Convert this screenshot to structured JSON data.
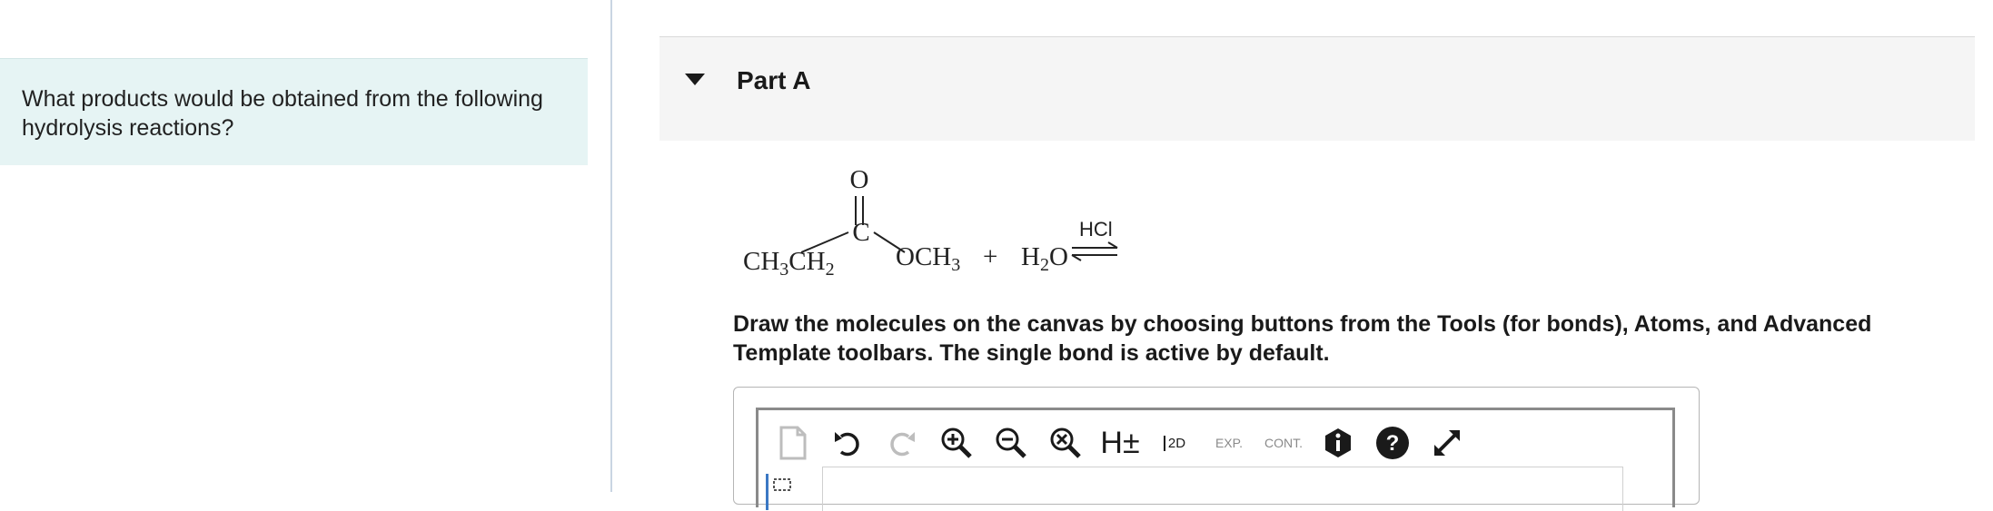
{
  "question": {
    "text": "What products would be obtained from the following hydrolysis reactions?"
  },
  "part": {
    "title": "Part A"
  },
  "reaction": {
    "left_group": "CH3CH2",
    "carbonyl_o": "O",
    "carbonyl_c": "C",
    "right_group": "OCH3",
    "plus": "+",
    "water": "H2O",
    "catalyst": "HCl"
  },
  "instructions": "Draw the molecules on the canvas by choosing buttons from the Tools (for bonds), Atoms, and Advanced Template toolbars. The single bond is active by default.",
  "toolbar": {
    "items": [
      {
        "name": "new-document-icon"
      },
      {
        "name": "undo-icon"
      },
      {
        "name": "redo-icon"
      },
      {
        "name": "zoom-in-icon"
      },
      {
        "name": "zoom-out-icon"
      },
      {
        "name": "zoom-reset-icon"
      },
      {
        "name": "hydrogen-toggle-icon",
        "label": "H±"
      },
      {
        "name": "clean-2d-icon",
        "label": "2D"
      },
      {
        "name": "expand-icon",
        "label": "EXP."
      },
      {
        "name": "contract-icon",
        "label": "CONT."
      },
      {
        "name": "info-icon"
      },
      {
        "name": "help-icon"
      },
      {
        "name": "fullscreen-icon"
      }
    ]
  },
  "colors": {
    "question_bg": "#e6f4f4",
    "part_header_bg": "#f5f5f5",
    "divider": "#c9d5e2"
  }
}
